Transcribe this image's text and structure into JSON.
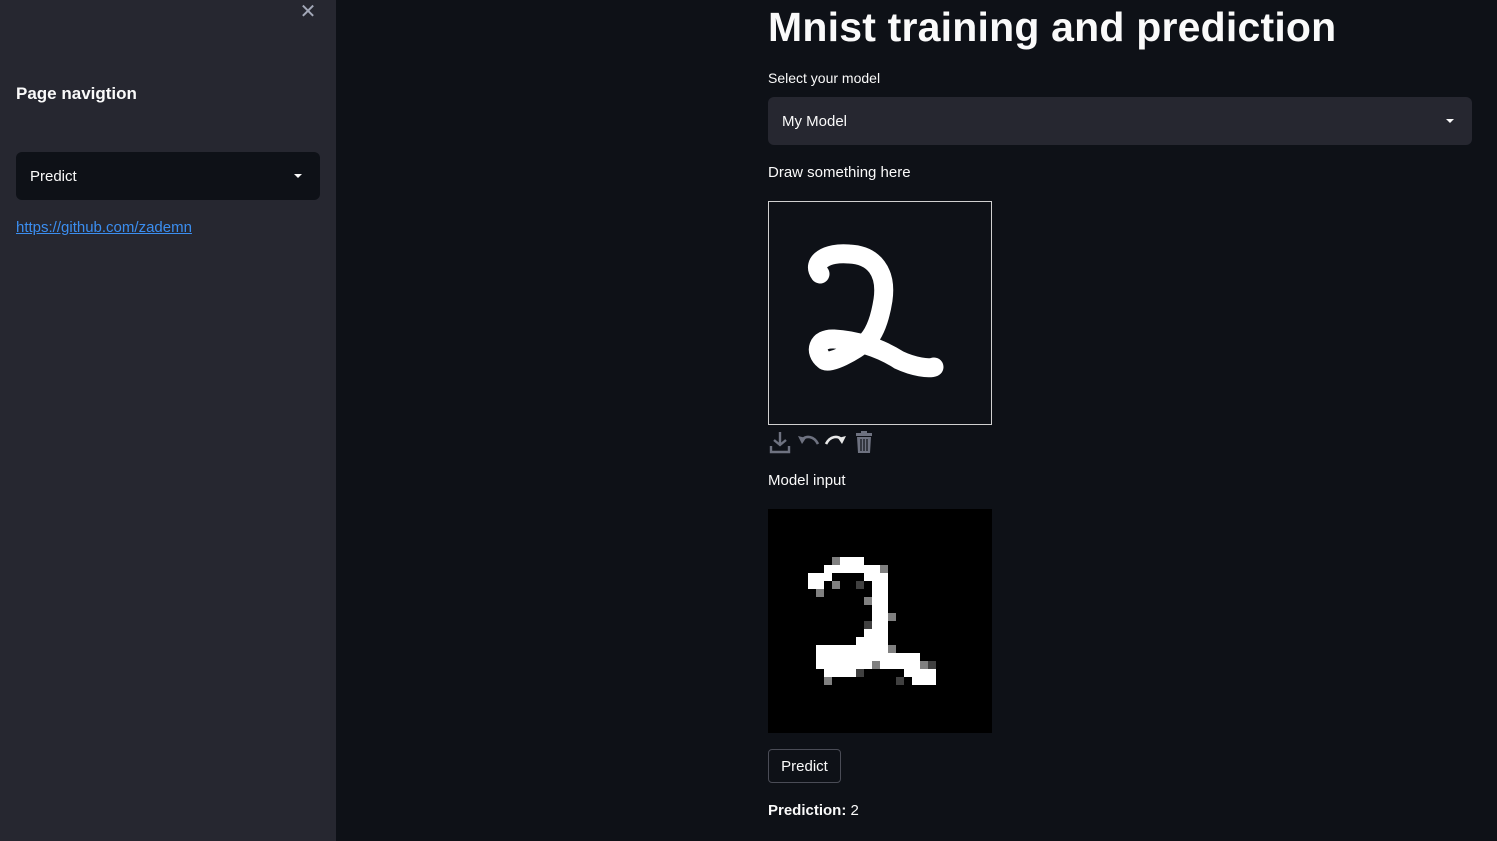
{
  "sidebar": {
    "close_icon": "close-icon",
    "heading": "Page navigtion",
    "page_select": {
      "value": "Predict"
    },
    "link": "https://github.com/zademn"
  },
  "main": {
    "title": "Mnist training and prediction",
    "model_select": {
      "label": "Select your model",
      "value": "My Model"
    },
    "canvas": {
      "label": "Draw something here",
      "toolbar": [
        "download-icon",
        "undo-icon",
        "redo-icon",
        "trash-icon"
      ]
    },
    "model_input": {
      "label": "Model input"
    },
    "predict_button": "Predict",
    "prediction": {
      "label": "Prediction:",
      "value": "2"
    }
  },
  "colors": {
    "background": "#0e1117",
    "sidebar": "#262730",
    "link": "#3b8ef0",
    "text": "#fafafa"
  }
}
